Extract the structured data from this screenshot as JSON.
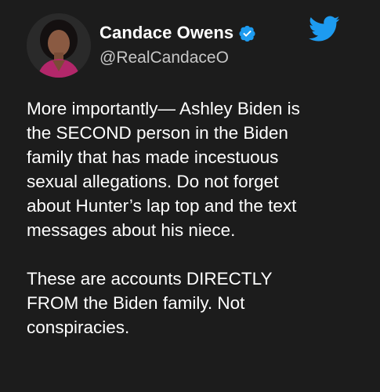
{
  "author": {
    "display_name": "Candace Owens",
    "handle": "@RealCandaceO",
    "verified_icon": "verified-badge-icon",
    "avatar": "profile-photo"
  },
  "brand": {
    "icon": "twitter-bird-icon",
    "color": "#1d9bf0"
  },
  "tweet": {
    "paragraph_1": "More importantly— Ashley Biden is\nthe SECOND person in the Biden\nfamily that has made incestuous\nsexual allegations. Do not forget\nabout Hunter’s lap top and the text\nmessages about his niece.",
    "paragraph_2": "These are accounts DIRECTLY\nFROM the Biden family. Not\nconspiracies."
  },
  "colors": {
    "background": "#1c1c1c",
    "text": "#ffffff",
    "handle_text": "#c7c7c7",
    "verified_badge": "#1d9bf0"
  }
}
